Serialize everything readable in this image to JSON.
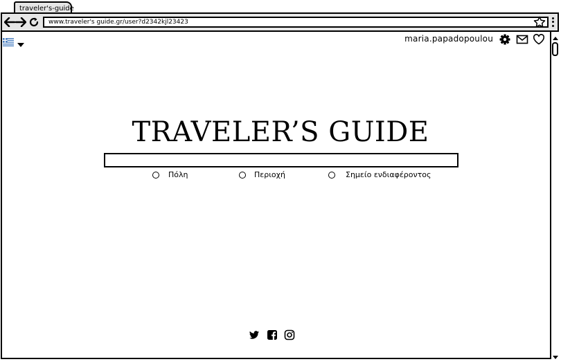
{
  "browser": {
    "tab_title": "traveler's-guide",
    "url": "www.traveler's guide.gr/user?d2342kjl23423"
  },
  "header": {
    "language_flag": "greece-flag-icon",
    "username": "maria.papadopoulou",
    "icons": [
      "gear-icon",
      "mail-icon",
      "heart-icon"
    ]
  },
  "main": {
    "title": "TRAVELER’S GUIDE",
    "search": {
      "value": "",
      "placeholder": ""
    },
    "search_options": [
      {
        "label": "Πόλη"
      },
      {
        "label": "Περιοχή"
      },
      {
        "label": "Σημείο ενδιαφέροντος"
      }
    ]
  },
  "footer": {
    "social_icons": [
      "twitter-icon",
      "facebook-icon",
      "instagram-icon"
    ]
  },
  "colors": {
    "frame": "#000000",
    "toolbar": "#e6e6e6",
    "flag_blue": "#4a7fc1"
  }
}
